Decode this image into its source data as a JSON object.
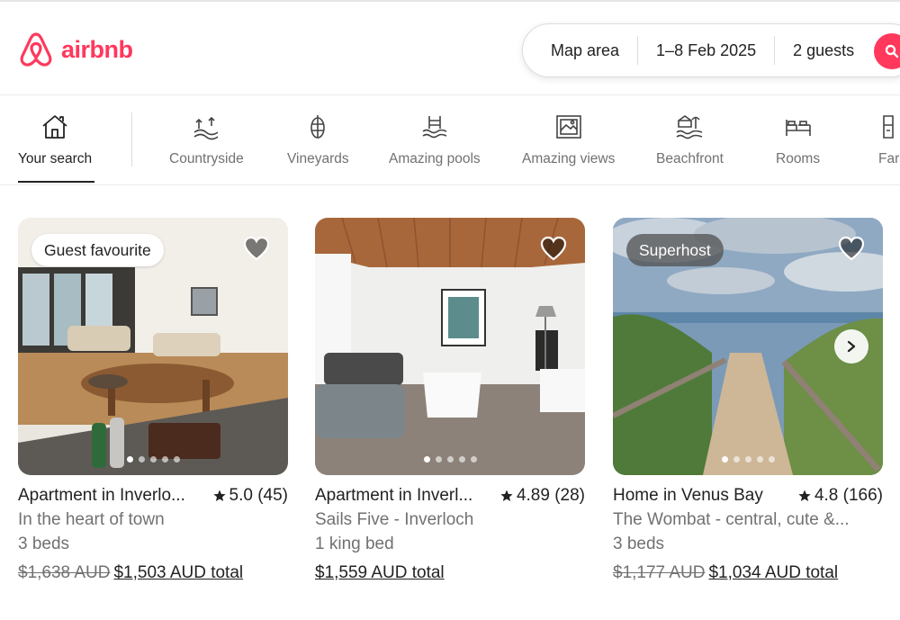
{
  "header": {
    "logo_text": "airbnb",
    "search": {
      "location": "Map area",
      "dates": "1–8 Feb 2025",
      "guests": "2 guests"
    }
  },
  "categories": [
    {
      "label": "Your search",
      "icon": "house-icon",
      "active": true
    },
    {
      "label": "Countryside",
      "icon": "countryside-icon"
    },
    {
      "label": "Vineyards",
      "icon": "grapes-icon"
    },
    {
      "label": "Amazing pools",
      "icon": "pool-icon"
    },
    {
      "label": "Amazing views",
      "icon": "framed-view-icon"
    },
    {
      "label": "Beachfront",
      "icon": "beach-icon"
    },
    {
      "label": "Rooms",
      "icon": "beds-icon"
    },
    {
      "label": "Far",
      "icon": "farm-icon"
    }
  ],
  "listings": [
    {
      "badge": "Guest favourite",
      "title": "Apartment in Inverlo...",
      "rating": "5.0 (45)",
      "subtitle": "In the heart of town",
      "beds": "3 beds",
      "old_price": "$1,638 AUD",
      "price": "$1,503 AUD total"
    },
    {
      "badge": "",
      "title": "Apartment in Inverl...",
      "rating": "4.89 (28)",
      "subtitle": "Sails Five - Inverloch",
      "beds": "1 king bed",
      "old_price": "",
      "price": "$1,559 AUD total"
    },
    {
      "badge": "Superhost",
      "title": "Home in Venus Bay",
      "rating": "4.8 (166)",
      "subtitle": "The Wombat - central, cute &...",
      "beds": "3 beds",
      "old_price": "$1,177 AUD",
      "price": "$1,034 AUD total"
    }
  ]
}
